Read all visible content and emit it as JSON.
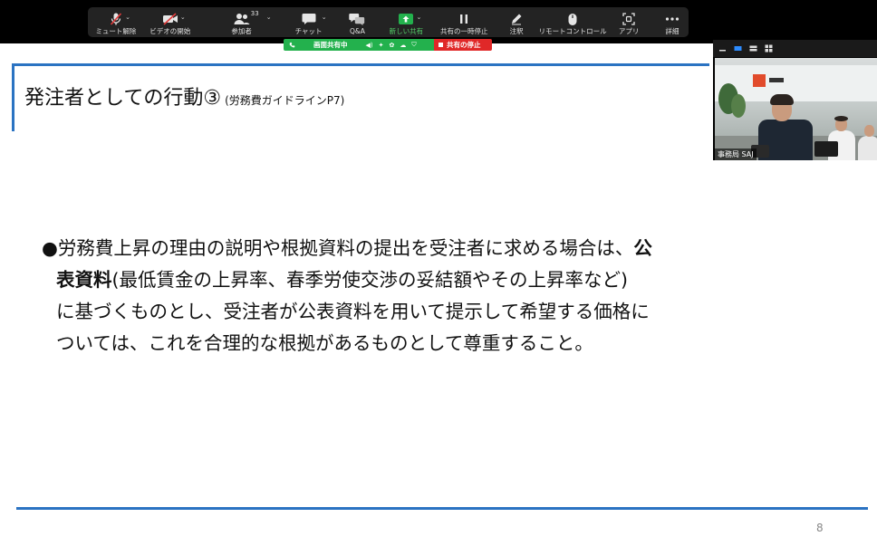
{
  "toolbar": {
    "items": [
      {
        "label": "ミュート解除",
        "icon": "mic-muted-icon",
        "caret": "⌄"
      },
      {
        "label": "ビデオの開始",
        "icon": "video-off-icon",
        "caret": "⌄"
      },
      {
        "label": "参加者",
        "icon": "participants-icon",
        "caret": "⌄",
        "count": "33"
      },
      {
        "label": "チャット",
        "icon": "chat-icon",
        "caret": "⌄"
      },
      {
        "label": "Q&A",
        "icon": "qa-icon"
      },
      {
        "label": "新しい共有",
        "icon": "share-up-icon",
        "caret": "⌄"
      },
      {
        "label": "共有の一時停止",
        "icon": "pause-icon"
      },
      {
        "label": "注釈",
        "icon": "pen-icon"
      },
      {
        "label": "リモートコントロール",
        "icon": "mouse-icon"
      },
      {
        "label": "アプリ",
        "icon": "apps-icon"
      },
      {
        "label": "詳細",
        "icon": "more-icon"
      }
    ],
    "accent_green": "#53d369"
  },
  "share_bar": {
    "status": "画面共有中",
    "stop_label": "共有の停止",
    "green": "#23b14d",
    "red": "#e02828"
  },
  "slide": {
    "title": "発注者としての行動③",
    "subtitle": "(労務費ガイドラインP7)",
    "bullet": "●",
    "line1_a": "労務費上昇の理由の説明や根拠資料の提出を受注者に求める場合は、",
    "line1_bold": "公",
    "line2_bold": "表資料",
    "line2_rest": "(最低賃金の上昇率、春季労使交渉の妥結額やその上昇率など)",
    "line3": "に基づくものとし、受注者が公表資料を用いて提示して希望する価格に",
    "line4": "ついては、これを合理的な根拠があるものとして尊重すること。",
    "page_number": "8",
    "accent": "#2b73c2"
  },
  "video_panel": {
    "participant_name": "事務局 SAJ"
  }
}
